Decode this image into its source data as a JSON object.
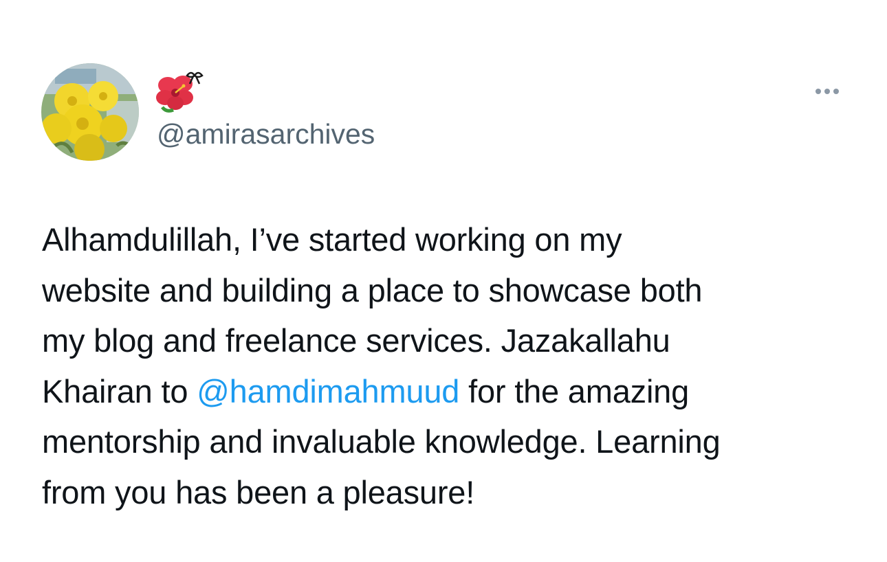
{
  "author": {
    "display_name_icons": [
      "hibiscus-icon",
      "ribbon-icon"
    ],
    "handle": "@amirasarchives",
    "avatar": "yellow-flowers-avatar"
  },
  "menu": {
    "more_icon": "more-horizontal-icon"
  },
  "tweet": {
    "line1": "Alhamdulillah, I’ve started working on my",
    "line2": "website and building a place to showcase both",
    "line3": "my blog and freelance services. Jazakallahu",
    "line4_before": "Khairan to ",
    "mention": "@hamdimahmuud",
    "line4_after": " for the amazing",
    "line5": "mentorship and invaluable knowledge. Learning",
    "line6": "from you has been a pleasure!"
  },
  "colors": {
    "text": "#0f1419",
    "secondary_text": "#536471",
    "link": "#1d9bf0",
    "background": "#ffffff"
  }
}
